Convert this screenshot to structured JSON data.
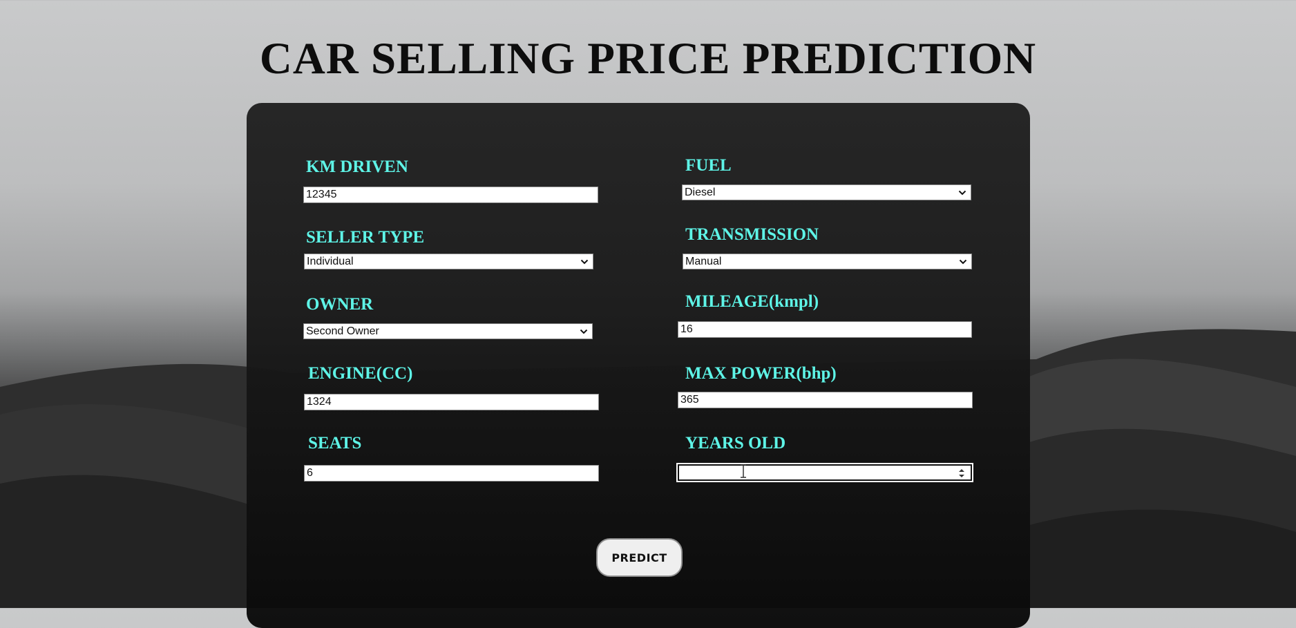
{
  "page": {
    "title": "CAR SELLING PRICE PREDICTION",
    "accent_color": "#5ef4e7"
  },
  "form": {
    "km_driven": {
      "label": "KM DRIVEN",
      "value": "12345"
    },
    "fuel": {
      "label": "FUEL",
      "selected": "Diesel"
    },
    "seller_type": {
      "label": "SELLER TYPE",
      "selected": "Individual"
    },
    "transmission": {
      "label": "TRANSMISSION",
      "selected": "Manual"
    },
    "owner": {
      "label": "OWNER",
      "selected": "Second Owner"
    },
    "mileage": {
      "label": "MILEAGE(kmpl)",
      "value": "16"
    },
    "engine": {
      "label": "ENGINE(CC)",
      "value": "1324"
    },
    "max_power": {
      "label": "MAX POWER(bhp)",
      "value": "365"
    },
    "seats": {
      "label": "SEATS",
      "value": "6"
    },
    "years_old": {
      "label": "YEARS OLD",
      "value": ""
    },
    "predict_button": {
      "label": "PREDICT"
    }
  }
}
